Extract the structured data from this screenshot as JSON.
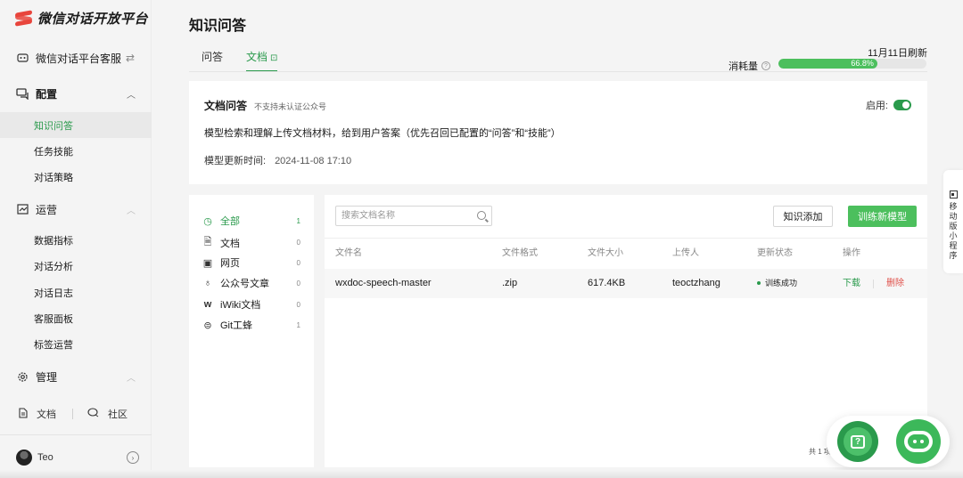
{
  "app": {
    "name": "微信对话开放平台"
  },
  "sidebar": {
    "switch_label": "微信对话平台客服",
    "groups": [
      {
        "title": "配置",
        "items": [
          "知识问答",
          "任务技能",
          "对话策略"
        ]
      },
      {
        "title": "运营",
        "items": [
          "数据指标",
          "对话分析",
          "对话日志",
          "客服面板",
          "标签运营"
        ]
      },
      {
        "title": "管理",
        "items": []
      }
    ],
    "links": {
      "docs": "文档",
      "community": "社区"
    },
    "user": "Teo"
  },
  "page": {
    "title": "知识问答",
    "tabs": [
      "问答",
      "文档"
    ],
    "refresh_text": "11月11日刷新",
    "usage_label": "消耗量",
    "usage_percent": 66.8,
    "usage_text": "66.8%"
  },
  "doc_card": {
    "title": "文档问答",
    "subtitle": "不支持未认证公众号",
    "enable_label": "启用:",
    "enabled": true,
    "description": "模型检索和理解上传文档材料，给到用户答案（优先召回已配置的“问答”和“技能”）",
    "update_label": "模型更新时间:",
    "update_time": "2024-11-08 17:10"
  },
  "categories": [
    {
      "name": "全部",
      "count": "1",
      "icon": "clock-icon"
    },
    {
      "name": "文档",
      "count": "0",
      "icon": "file-icon"
    },
    {
      "name": "网页",
      "count": "0",
      "icon": "webpage-icon"
    },
    {
      "name": "公众号文章",
      "count": "0",
      "icon": "official-account-icon"
    },
    {
      "name": "iWiki文档",
      "count": "0",
      "icon": "iwiki-icon"
    },
    {
      "name": "Git工蜂",
      "count": "1",
      "icon": "git-icon"
    }
  ],
  "toolbar": {
    "search_placeholder": "搜索文档名称",
    "add_label": "知识添加",
    "train_label": "训练新模型"
  },
  "table": {
    "headers": [
      "文件名",
      "文件格式",
      "文件大小",
      "上传人",
      "更新状态",
      "操作"
    ],
    "rows": [
      {
        "name": "wxdoc-speech-master",
        "format": ".zip",
        "size": "617.4KB",
        "uploader": "teoctzhang",
        "status": "训练成功",
        "download": "下载",
        "delete": "删除"
      }
    ],
    "total": "共 1 项"
  },
  "mobile_tab": "移动版小程序",
  "colors": {
    "accent": "#2a9a4c",
    "progress": "#4cbf5d",
    "danger": "#e0504a",
    "brand": "#e8453c"
  }
}
